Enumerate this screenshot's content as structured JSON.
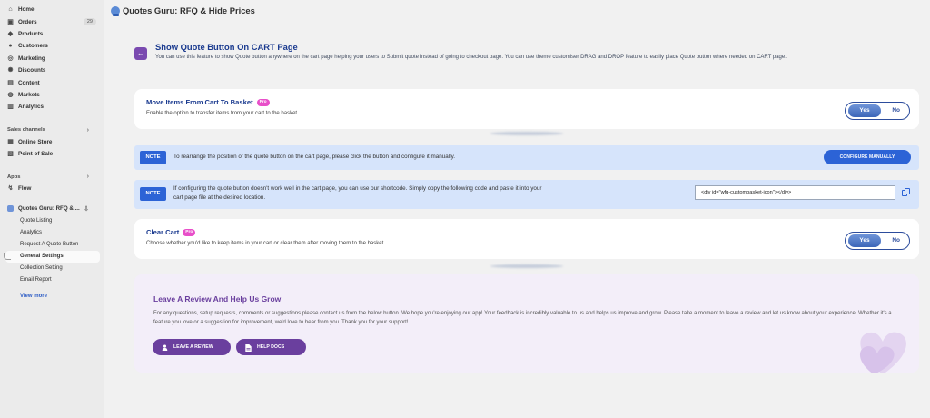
{
  "sidebar": {
    "items": [
      {
        "label": "Home",
        "icon": "home-icon",
        "glyph": "⌂"
      },
      {
        "label": "Orders",
        "icon": "orders-icon",
        "glyph": "▣",
        "badge": "29"
      },
      {
        "label": "Products",
        "icon": "tag-icon",
        "glyph": "◆"
      },
      {
        "label": "Customers",
        "icon": "person-icon",
        "glyph": "●"
      },
      {
        "label": "Marketing",
        "icon": "target-icon",
        "glyph": "◎"
      },
      {
        "label": "Discounts",
        "icon": "discount-icon",
        "glyph": "✺"
      },
      {
        "label": "Content",
        "icon": "content-icon",
        "glyph": "▤"
      },
      {
        "label": "Markets",
        "icon": "globe-icon",
        "glyph": "◍"
      },
      {
        "label": "Analytics",
        "icon": "chart-icon",
        "glyph": "▥"
      }
    ],
    "sales_channels_label": "Sales channels",
    "sales_channels": [
      {
        "label": "Online Store",
        "icon": "store-icon",
        "glyph": "▦"
      },
      {
        "label": "Point of Sale",
        "icon": "pos-icon",
        "glyph": "▧"
      }
    ],
    "apps_label": "Apps",
    "apps": [
      {
        "label": "Flow",
        "icon": "flow-icon",
        "glyph": "↯"
      }
    ],
    "app_name": "Quotes Guru: RFQ & ...",
    "app_subitems": [
      "Quote Listing",
      "Analytics",
      "Request A Quote Button",
      "General Settings",
      "Collection Setting",
      "Email Report"
    ],
    "active_subitem": "General Settings",
    "view_more": "View more"
  },
  "header": {
    "title": "Quotes Guru: RFQ & Hide Prices"
  },
  "hero": {
    "title": "Show Quote Button On CART Page",
    "description": "You can use this feature to show Quote button anywhere on the cart page helping your users to Submit quote instead of going to checkout page. You can use theme customiser DRAG and DROP feature to easily place Quote button where needed on CART page."
  },
  "move_items": {
    "title": "Move Items From Cart To Basket",
    "badge": "Pro",
    "description": "Enable the option to transfer items from your cart to the basket",
    "yes": "Yes",
    "no": "No",
    "selected": "Yes"
  },
  "note1": {
    "tag": "NOTE",
    "text": "To rearrange the position of the quote button on the cart page, please click the button and configure it manually.",
    "button": "CONFIGURE MANUALLY"
  },
  "note2": {
    "tag": "NOTE",
    "text_line1": "If configuring the quote button doesn't work well in the cart page, you can use our shortcode. Simply copy the following code and paste it into your",
    "text_line2": "cart page file at the desired location.",
    "code": "<div id=\"wfq-custombasket-icon\"></div>"
  },
  "clear_cart": {
    "title": "Clear Cart",
    "badge": "Pro",
    "description": "Choose whether you'd like to keep items in your cart or clear them after moving them to the basket.",
    "yes": "Yes",
    "no": "No",
    "selected": "Yes"
  },
  "review": {
    "title": "Leave A Review And Help Us Grow",
    "text": "For any questions, setup requests, comments or suggestions please contact us from the below button. We hope you're enjoying our app! Your feedback is incredibly valuable to us and helps us improve and grow. Please take a moment to leave a review and let us know about your experience. Whether it's a feature you love or a suggestion for improvement, we'd love to hear from you. Thank you for your support!",
    "leave_review": "LEAVE A REVIEW",
    "help_docs": "HELP DOCS"
  },
  "colors": {
    "accent": "#1a3a8f",
    "purple": "#6a3f9e",
    "note_bg": "#d6e4fb",
    "note_blue": "#2c63d6",
    "pro_pink": "#e84fc9"
  }
}
